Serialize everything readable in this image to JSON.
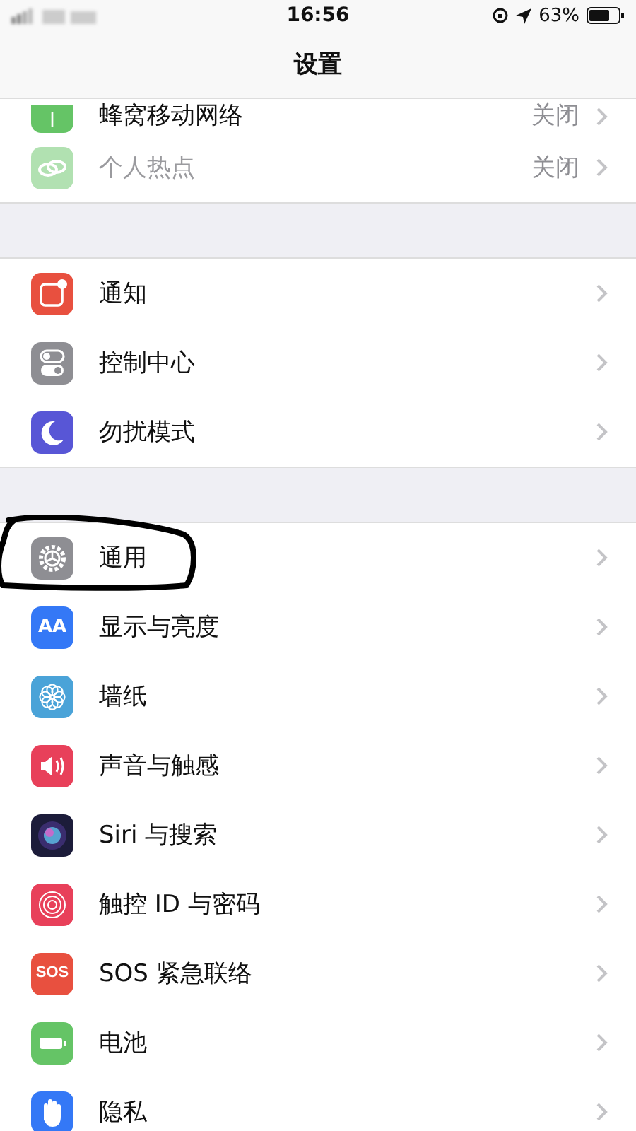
{
  "status_bar": {
    "time": "16:56",
    "battery": "63%"
  },
  "nav": {
    "title": "设置"
  },
  "groups": [
    {
      "items": [
        {
          "kind": "cellular",
          "label": "蜂窝移动网络",
          "value": "关闭",
          "disabled": false,
          "highlight": false,
          "cut": true
        },
        {
          "kind": "hotspot",
          "label": "个人热点",
          "value": "关闭",
          "disabled": true,
          "highlight": false,
          "cut": false
        }
      ]
    },
    {
      "items": [
        {
          "kind": "notifications",
          "label": "通知",
          "disabled": false,
          "highlight": false,
          "cut": false
        },
        {
          "kind": "control",
          "label": "控制中心",
          "disabled": false,
          "highlight": false,
          "cut": false
        },
        {
          "kind": "dnd",
          "label": "勿扰模式",
          "disabled": false,
          "highlight": false,
          "cut": false
        }
      ]
    },
    {
      "items": [
        {
          "kind": "general",
          "label": "通用",
          "disabled": false,
          "highlight": true,
          "cut": false
        },
        {
          "kind": "display",
          "icon_text": "AA",
          "label": "显示与亮度",
          "disabled": false,
          "highlight": false,
          "cut": false
        },
        {
          "kind": "wallpaper",
          "label": "墙纸",
          "disabled": false,
          "highlight": false,
          "cut": false
        },
        {
          "kind": "sounds",
          "label": "声音与触感",
          "disabled": false,
          "highlight": false,
          "cut": false
        },
        {
          "kind": "siri",
          "label": "Siri 与搜索",
          "disabled": false,
          "highlight": false,
          "cut": false
        },
        {
          "kind": "touchid",
          "label": "触控 ID 与密码",
          "disabled": false,
          "highlight": false,
          "cut": false
        },
        {
          "kind": "sos",
          "icon_text": "SOS",
          "label": "SOS 紧急联络",
          "disabled": false,
          "highlight": false,
          "cut": false
        },
        {
          "kind": "battery",
          "label": "电池",
          "disabled": false,
          "highlight": false,
          "cut": false
        },
        {
          "kind": "privacy",
          "label": "隐私",
          "disabled": false,
          "highlight": false,
          "cut": false
        }
      ]
    }
  ]
}
